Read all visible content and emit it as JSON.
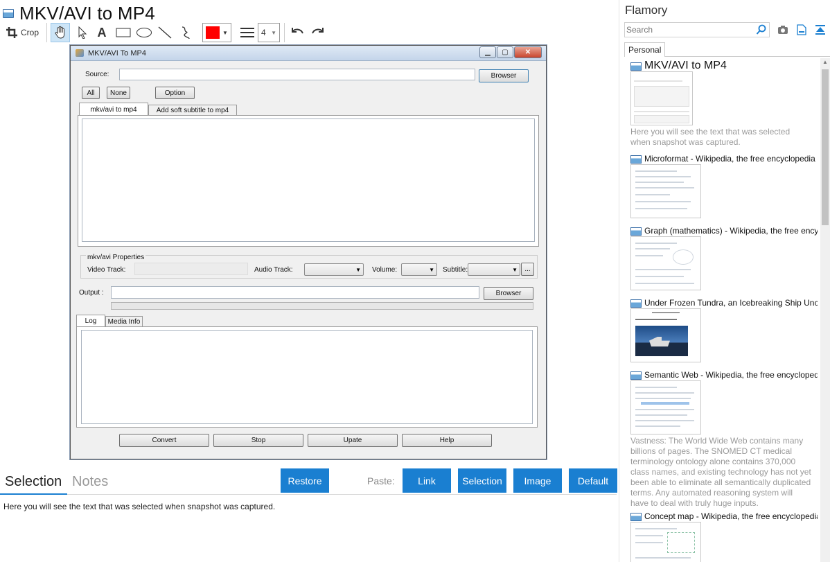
{
  "page": {
    "title": "MKV/AVI to MP4"
  },
  "toolbar": {
    "crop_label": "Crop",
    "line_width_value": "4",
    "colors": {
      "selected_color": "#ff0000"
    }
  },
  "screenshot": {
    "window_title": "MKV/AVI To MP4",
    "source_label": "Source:",
    "browser_label": "Browser",
    "all_label": "All",
    "none_label": "None",
    "option_label": "Option",
    "tabs": [
      "mkv/avi to mp4",
      "Add soft subtitle to mp4"
    ],
    "properties_label": "mkv/avi Properties",
    "video_track_label": "Video Track:",
    "audio_track_label": "Audio Track:",
    "volume_label": "Volume:",
    "subtitle_label": "Subtitle:",
    "ellipsis_label": "...",
    "output_label": "Output :",
    "output_browser_label": "Browser",
    "log_tabs": [
      "Log",
      "Media Info"
    ],
    "action_buttons": [
      "Convert",
      "Stop",
      "Upate",
      "Help"
    ]
  },
  "bottom": {
    "tab_selection": "Selection",
    "tab_notes": "Notes",
    "restore_label": "Restore",
    "paste_label": "Paste:",
    "paste_buttons": [
      "Link",
      "Selection",
      "Image",
      "Default"
    ],
    "selection_text": "Here you will see the text that was selected when snapshot was captured."
  },
  "sidebar": {
    "app_title": "Flamory",
    "search_placeholder": "Search",
    "tab_personal": "Personal",
    "entries": [
      {
        "title": "MKV/AVI to MP4",
        "note": "Here you will see the text that was selected when snapshot was captured."
      },
      {
        "title": "Microformat - Wikipedia, the free encyclopedia"
      },
      {
        "title": "Graph (mathematics) - Wikipedia, the free ency"
      },
      {
        "title": "Under Frozen Tundra, an Icebreaking Ship Unco"
      },
      {
        "title": "Semantic Web - Wikipedia, the free encycloped",
        "note": "Vastness: The World Wide Web contains many billions of pages. The SNOMED CT medical terminology ontology alone contains 370,000 class names, and existing technology has not yet been able to eliminate all semantically duplicated terms. Any automated reasoning system will have to deal with truly huge inputs."
      },
      {
        "title": "Concept map - Wikipedia, the free encyclopedia"
      }
    ]
  }
}
